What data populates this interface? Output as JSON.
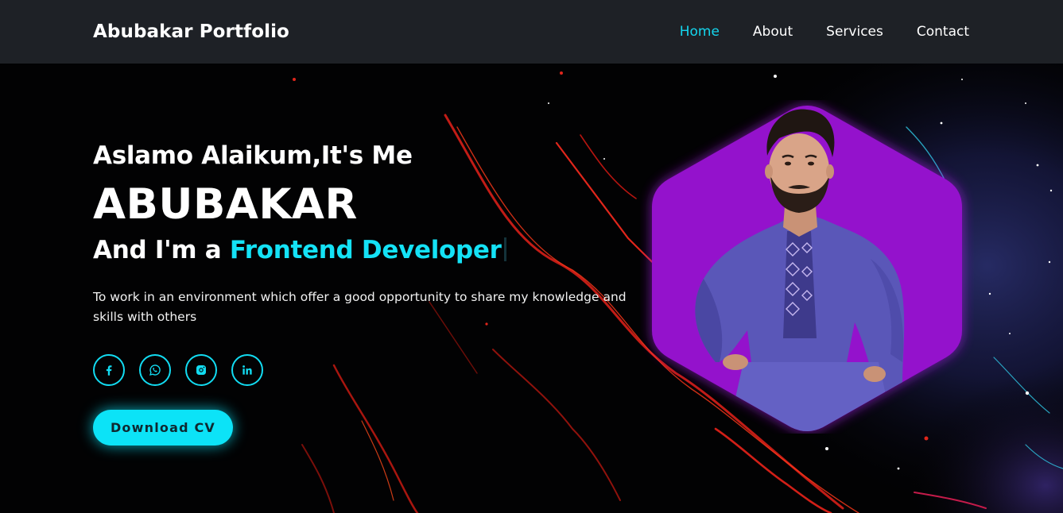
{
  "header": {
    "brand": "Abubakar Portfolio",
    "nav": [
      {
        "label": "Home",
        "active": true
      },
      {
        "label": "About",
        "active": false
      },
      {
        "label": "Services",
        "active": false
      },
      {
        "label": "Contact",
        "active": false
      }
    ]
  },
  "hero": {
    "greeting": "Aslamo Alaikum,It's Me",
    "name": "ABUBAKAR",
    "role_prefix": "And I'm a ",
    "role_highlight": "Frontend Developer",
    "description": "To work in an environment which offer a good opportunity to share my knowledge and skills with others",
    "socials": [
      {
        "icon": "facebook-icon"
      },
      {
        "icon": "whatsapp-icon"
      },
      {
        "icon": "instagram-icon"
      },
      {
        "icon": "linkedin-icon"
      }
    ],
    "cta_label": "Download CV"
  },
  "colors": {
    "accent": "#14e2f6",
    "header_bg": "#1e2126",
    "hexagon": "#9412cc",
    "page_bg": "#020203"
  }
}
